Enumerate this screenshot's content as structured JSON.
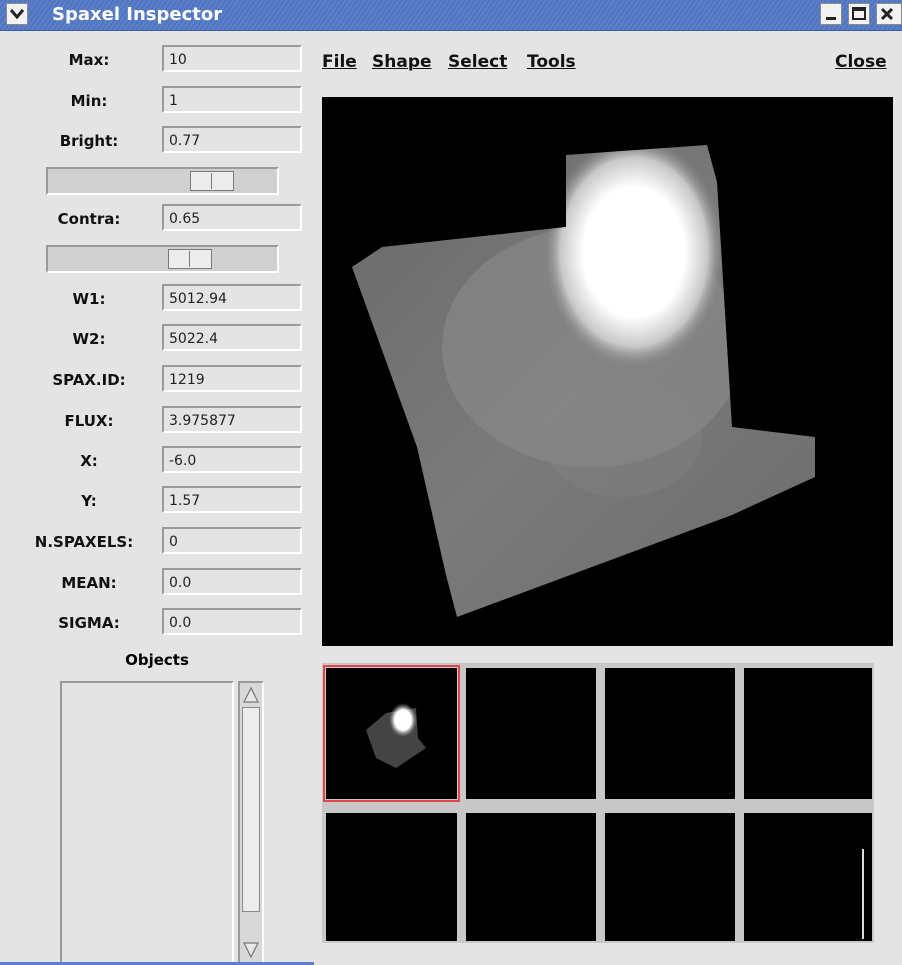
{
  "window": {
    "title": "Spaxel Inspector",
    "icons": {
      "menu": "chevron-down-icon",
      "minimize": "minimize-icon",
      "maximize": "maximize-icon",
      "close": "close-icon"
    },
    "colors": {
      "titlebar": "#5c80c8",
      "panel_bg": "#e4e4e4",
      "selection_outline": "#e04848"
    }
  },
  "controls": {
    "max": {
      "label": "Max:",
      "value": "10"
    },
    "min": {
      "label": "Min:",
      "value": "1"
    },
    "bright": {
      "label": "Bright:",
      "value": "0.77",
      "slider_level": 0.77
    },
    "contra": {
      "label": "Contra:",
      "value": "0.65",
      "slider_level": 0.65
    },
    "w1": {
      "label": "W1:",
      "value": "5012.94"
    },
    "w2": {
      "label": "W2:",
      "value": "5022.4"
    },
    "spax_id": {
      "label": "SPAX.ID:",
      "value": "1219"
    },
    "flux": {
      "label": "FLUX:",
      "value": "3.975877"
    },
    "x": {
      "label": "X:",
      "value": "-6.0"
    },
    "y": {
      "label": "Y:",
      "value": "1.57"
    },
    "nspaxels": {
      "label": "N.SPAXELS:",
      "value": "0"
    },
    "mean": {
      "label": "MEAN:",
      "value": "0.0"
    },
    "sigma": {
      "label": "SIGMA:",
      "value": "0.0"
    }
  },
  "objects": {
    "label": "Objects",
    "items": [],
    "icons": {
      "up": "triangle-up-icon",
      "down": "triangle-down-icon"
    }
  },
  "menubar": {
    "file": "File",
    "shape": "Shape",
    "select": "Select",
    "tools": "Tools",
    "close": "Close"
  },
  "thumbnails": {
    "count": 8,
    "selected_index": 0
  }
}
